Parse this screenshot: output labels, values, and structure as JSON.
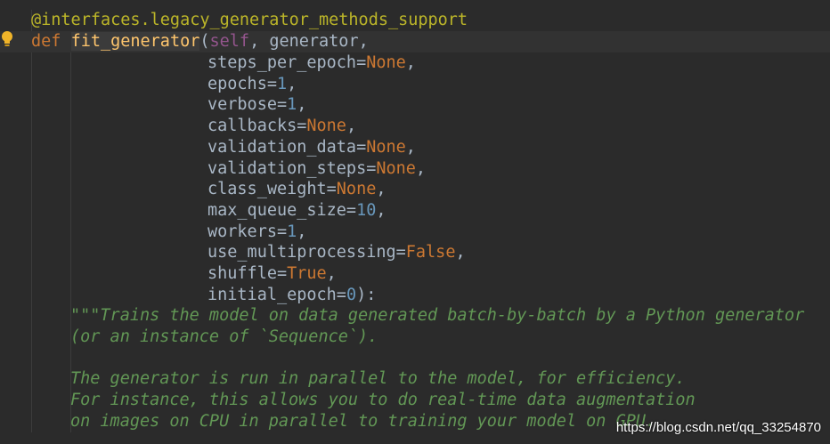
{
  "editor": {
    "line1": {
      "decorator": "@interfaces.legacy_generator_methods_support"
    },
    "line2": {
      "keyword": "def",
      "space": " ",
      "fn_name": "fit_generator",
      "paren": "(",
      "self": "self",
      "rest": ", generator,"
    },
    "params": [
      {
        "name": "steps_per_epoch=",
        "value": "None",
        "value_type": "kw",
        "suffix": ","
      },
      {
        "name": "epochs=",
        "value": "1",
        "value_type": "num",
        "suffix": ","
      },
      {
        "name": "verbose=",
        "value": "1",
        "value_type": "num",
        "suffix": ","
      },
      {
        "name": "callbacks=",
        "value": "None",
        "value_type": "kw",
        "suffix": ","
      },
      {
        "name": "validation_data=",
        "value": "None",
        "value_type": "kw",
        "suffix": ","
      },
      {
        "name": "validation_steps=",
        "value": "None",
        "value_type": "kw",
        "suffix": ","
      },
      {
        "name": "class_weight=",
        "value": "None",
        "value_type": "kw",
        "suffix": ","
      },
      {
        "name": "max_queue_size=",
        "value": "10",
        "value_type": "num",
        "suffix": ","
      },
      {
        "name": "workers=",
        "value": "1",
        "value_type": "num",
        "suffix": ","
      },
      {
        "name": "use_multiprocessing=",
        "value": "False",
        "value_type": "kw",
        "suffix": ","
      },
      {
        "name": "shuffle=",
        "value": "True",
        "value_type": "kw",
        "suffix": ","
      },
      {
        "name": "initial_epoch=",
        "value": "0",
        "value_type": "num",
        "suffix": "):"
      }
    ],
    "docstring": [
      "\"\"\"Trains the model on data generated batch-by-batch by a Python generator",
      "(or an instance of `Sequence`).",
      "",
      "The generator is run in parallel to the model, for efficiency.",
      "For instance, this allows you to do real-time data augmentation",
      "on images on CPU in parallel to training your model on GPU."
    ]
  },
  "watermark": "https://blog.csdn.net/qq_33254870",
  "colors": {
    "background": "#2b2b2b",
    "keyword": "#cc7832",
    "function": "#ffc66d",
    "self": "#94558d",
    "number": "#6897bb",
    "decorator": "#bbb529",
    "docstring": "#629755",
    "text": "#a9b7c6"
  },
  "icons": {
    "gutter": "lightbulb-icon"
  }
}
